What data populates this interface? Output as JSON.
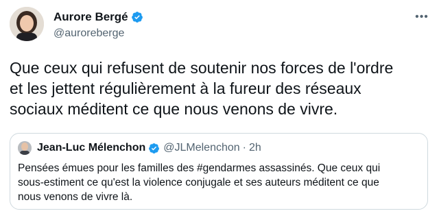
{
  "tweet": {
    "author_name": "Aurore Bergé",
    "author_handle": "@auroreberge",
    "verified": true,
    "more_icon": "ellipsis-icon",
    "text": "Que ceux qui refusent de soutenir nos forces de l'ordre\net les jettent régulièrement à la fureur des réseaux\nsociaux méditent ce que nous venons de vivre."
  },
  "quoted_tweet": {
    "author_name": "Jean-Luc Mélenchon",
    "author_handle": "@JLMelenchon",
    "separator": "·",
    "time": "2h",
    "verified": true,
    "text": "Pensées émues pour les familles des #gendarmes assassinés. Que ceux qui\nsous-estiment ce qu'est la violence conjugale et ses auteurs méditent ce que\nnous venons de vivre là."
  },
  "colors": {
    "verified_blue": "#1d9bf0",
    "secondary_text": "#536471",
    "border": "#cfd9de"
  }
}
